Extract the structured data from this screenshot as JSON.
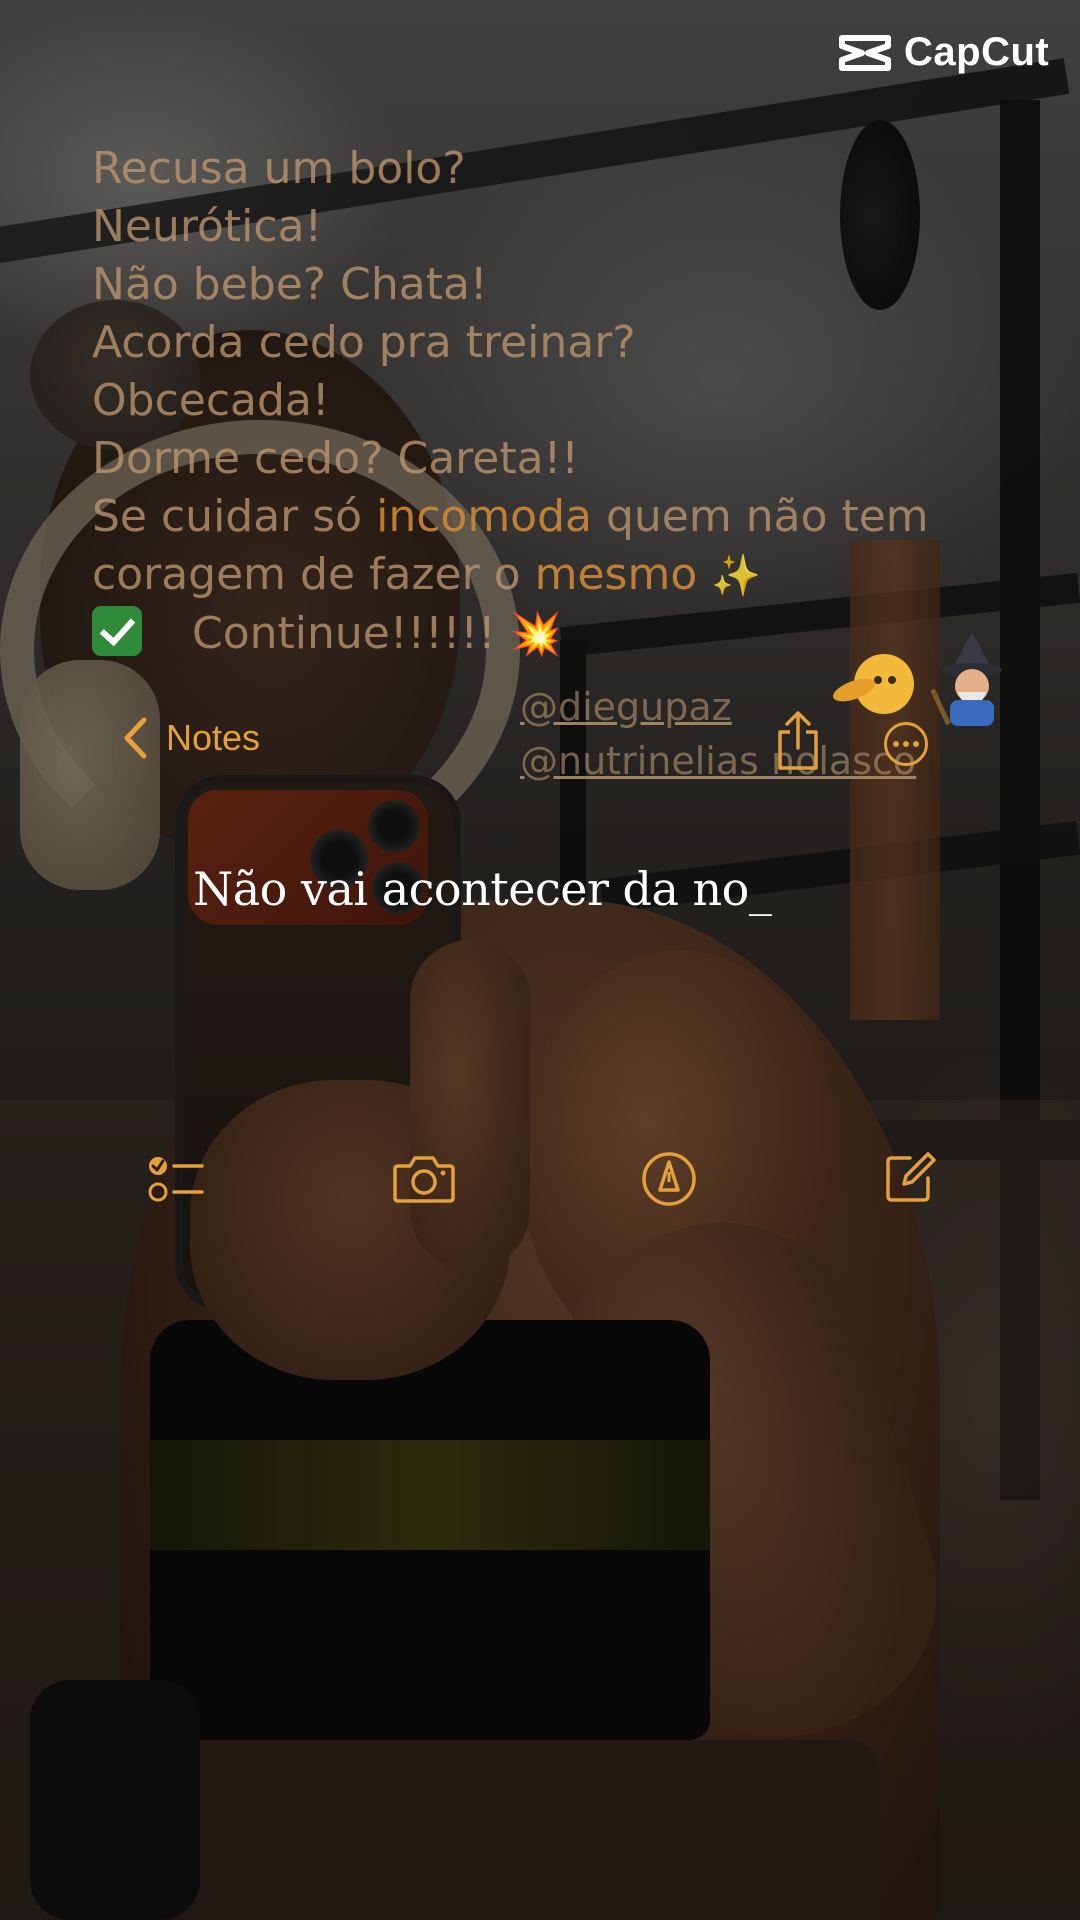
{
  "watermark": {
    "brand": "CapCut"
  },
  "quote": {
    "line1": "Recusa um bolo?",
    "line2": "Neurótica!",
    "line3": "Não bebe? Chata!",
    "line4": "Acorda cedo pra treinar?",
    "line5": "Obcecada!",
    "line6": "Dorme cedo? Careta!!",
    "line7_a": "Se cuidar só ",
    "line7_hl": "incomoda",
    "line7_b": " quem não tem",
    "line8_a": "coragem de fazer o ",
    "line8_hl": "mesmo",
    "line8_sparkle": "✨",
    "line9": "Continue!!!!!!",
    "line9_burst": "💥"
  },
  "handles": [
    "@diegupaz",
    "@nutrinelias nolasco"
  ],
  "notes_nav": {
    "back_label": "Notes"
  },
  "note": {
    "typed_text": "Não vai acontecer da no_"
  },
  "icons": {
    "back": "chevron-left-icon",
    "share": "share-icon",
    "more": "ellipsis-circle-icon",
    "checklist": "checklist-icon",
    "camera": "camera-icon",
    "markup": "pen-tip-icon",
    "compose": "compose-icon"
  },
  "colors": {
    "accent": "#e3a03c",
    "quote_text": "#be966e",
    "highlight": "#cd8737",
    "typed_text": "#ffffff"
  }
}
